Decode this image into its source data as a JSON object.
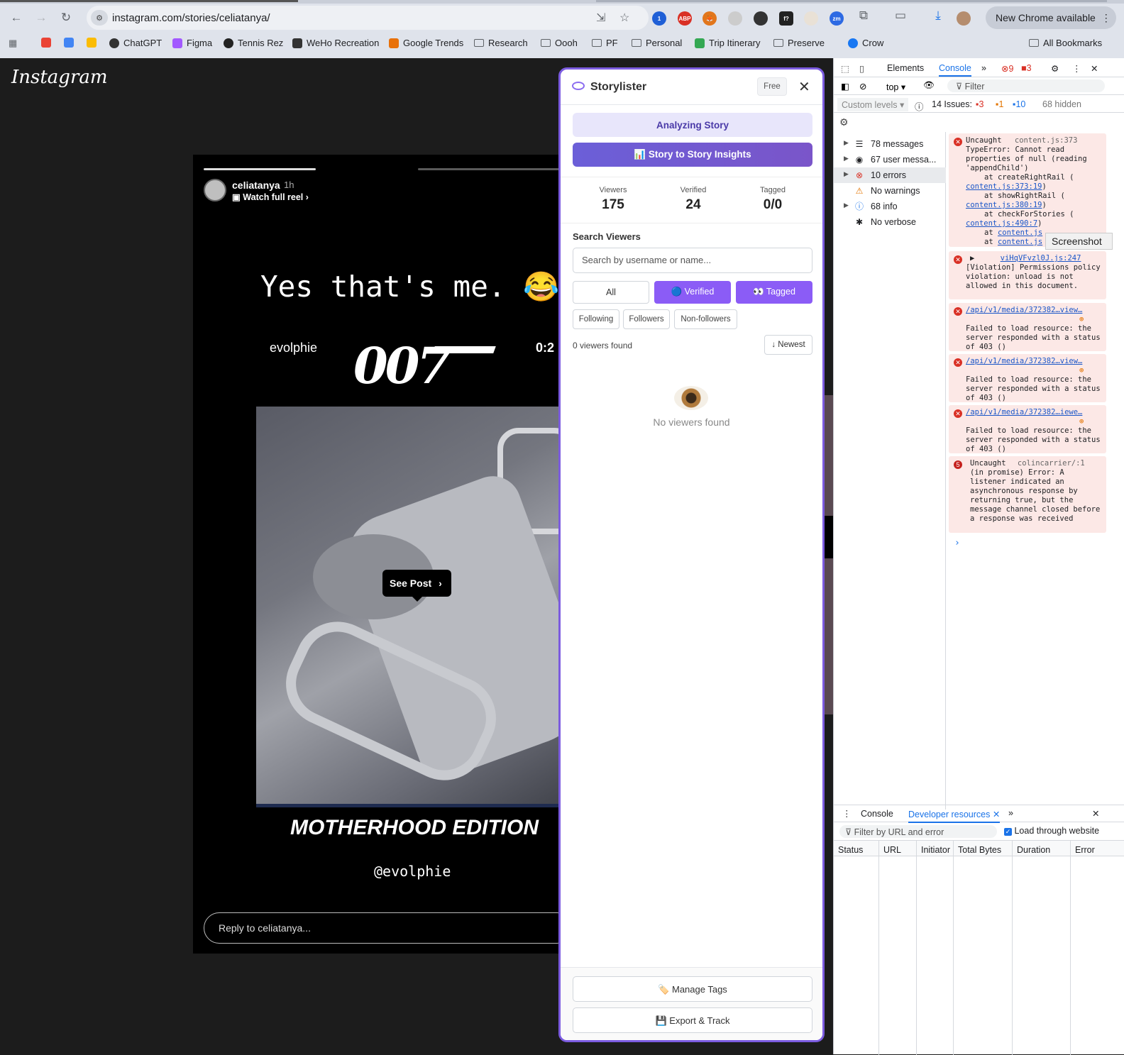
{
  "browser": {
    "url": "instagram.com/stories/celiatanya/",
    "new_chrome": "New Chrome available",
    "bookmarks": [
      "ChatGPT",
      "Figma",
      "Tennis Rez",
      "WeHo Recreation",
      "Google Trends",
      "Research",
      "Oooh",
      "PF",
      "Personal",
      "Trip Itinerary",
      "Preserve",
      "Crow"
    ],
    "all_bookmarks": "All Bookmarks",
    "ext_labels": {
      "abp": "ABP",
      "zm": "zm",
      "f": "f?"
    }
  },
  "instagram": {
    "logo": "Instagram",
    "story": {
      "username": "celiatanya",
      "time": "1h",
      "watch_full_reel": "Watch full reel",
      "caption": "Yes that's me. 😂",
      "video_user": "evolphie",
      "video_logo": "007",
      "video_time": "0:2",
      "see_post": "See Post",
      "edition": "MOTHERHOOD EDITION",
      "handle": "@evolphie",
      "reply_placeholder": "Reply to celiatanya..."
    }
  },
  "storylister": {
    "title": "Storylister",
    "plan": "Free",
    "analyzing": "Analyzing Story",
    "insights": "📊 Story to Story Insights",
    "stats": [
      {
        "label": "Viewers",
        "value": "175"
      },
      {
        "label": "Verified",
        "value": "24"
      },
      {
        "label": "Tagged",
        "value": "0/0"
      }
    ],
    "search_label": "Search Viewers",
    "search_placeholder": "Search by username or name...",
    "filters": [
      "All",
      "🔵 Verified",
      "👀 Tagged"
    ],
    "sub_filters": [
      "Following",
      "Followers",
      "Non-followers"
    ],
    "found": "0 viewers found",
    "sort": "↓ Newest",
    "empty": "No viewers found",
    "manage_tags": "🏷️ Manage Tags",
    "export": "💾 Export & Track",
    "accent": "#7c5ce0"
  },
  "devtools": {
    "tabs": [
      "Elements",
      "Console"
    ],
    "error_count": "9",
    "warn_count": "3",
    "context": "top",
    "filter_placeholder": "Filter",
    "levels": "Custom levels",
    "issues": "14 Issues:",
    "issue_counts": [
      "3",
      "1",
      "10"
    ],
    "hidden": "68 hidden",
    "sidebar": [
      {
        "label": "78 messages",
        "icon": "list-icon"
      },
      {
        "label": "67 user messa...",
        "icon": "user-icon"
      },
      {
        "label": "10 errors",
        "icon": "error-icon"
      },
      {
        "label": "No warnings",
        "icon": "warning-icon"
      },
      {
        "label": "68 info",
        "icon": "info-icon"
      },
      {
        "label": "No verbose",
        "icon": "bug-icon"
      }
    ],
    "messages": {
      "m1": {
        "head": "Uncaught",
        "src": "content.js:373",
        "text": "TypeError: Cannot read properties of null (reading 'appendChild')",
        "l1a": "at createRightRail (",
        "l1b": "content.js:373:19",
        "l1c": ")",
        "l2a": "at showRightRail (",
        "l2b": "content.js:380:19",
        "l2c": ")",
        "l3a": "at checkForStories (",
        "l3b": "content.js:490:7",
        "l3c": ")",
        "l4a": "at ",
        "l4b": "content.js",
        "l5a": "at ",
        "l5b": "content.js"
      },
      "m2": {
        "src": "viHqVFvzl0J.js:247",
        "text": "[Violation] Permissions policy violation: unload is not allowed in this document."
      },
      "m3": {
        "src": "/api/v1/media/372382…view…",
        "text": "Failed to load resource: the server responded with a status of 403 ()"
      },
      "m4": {
        "src": "/api/v1/media/372382…view…",
        "text": "Failed to load resource: the server responded with a status of 403 ()"
      },
      "m5": {
        "src": "/api/v1/media/372382…iewe…",
        "text": "Failed to load resource: the server responded with a status of 403 ()"
      },
      "m6": {
        "count": "5",
        "head": "Uncaught",
        "src": "colincarrier/:1",
        "text": "(in promise) Error: A listener indicated an asynchronous response by returning true, but the message channel closed before a response was received"
      }
    },
    "screenshot_tooltip": "Screenshot",
    "bottom_tabs": [
      "Console",
      "Developer resources"
    ],
    "bottom_filter": "Filter by URL and error",
    "load_through": "Load through website",
    "columns": [
      "Status",
      "URL",
      "Initiator",
      "Total Bytes",
      "Duration",
      "Error"
    ]
  }
}
